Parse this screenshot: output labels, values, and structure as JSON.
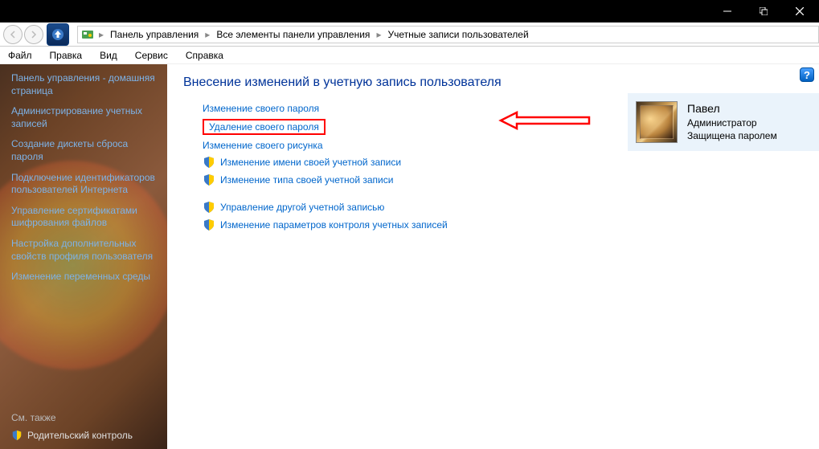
{
  "titlebar": {},
  "breadcrumb": {
    "items": [
      "Панель управления",
      "Все элементы панели управления",
      "Учетные записи пользователей"
    ]
  },
  "menu": {
    "items": [
      "Файл",
      "Правка",
      "Вид",
      "Сервис",
      "Справка"
    ]
  },
  "sidebar": {
    "links": [
      "Панель управления - домашняя страница",
      "Администрирование учетных записей",
      "Создание дискеты сброса пароля",
      "Подключение идентификаторов пользователей Интернета",
      "Управление сертификатами шифрования файлов",
      "Настройка дополнительных свойств профиля пользователя",
      "Изменение переменных среды"
    ],
    "see_also": "См. также",
    "parental": "Родительский контроль"
  },
  "main": {
    "heading": "Внесение изменений в учетную запись пользователя",
    "actions": [
      {
        "label": "Изменение своего пароля",
        "shield": false
      },
      {
        "label": "Удаление своего пароля",
        "shield": false,
        "highlight": true
      },
      {
        "label": "Изменение своего рисунка",
        "shield": false
      },
      {
        "label": "Изменение имени своей учетной записи",
        "shield": true
      },
      {
        "label": "Изменение типа своей учетной записи",
        "shield": true
      }
    ],
    "actions2": [
      {
        "label": "Управление другой учетной записью",
        "shield": true
      },
      {
        "label": "Изменение параметров контроля учетных записей",
        "shield": true
      }
    ]
  },
  "user": {
    "name": "Павел",
    "role": "Администратор",
    "status": "Защищена паролем"
  }
}
